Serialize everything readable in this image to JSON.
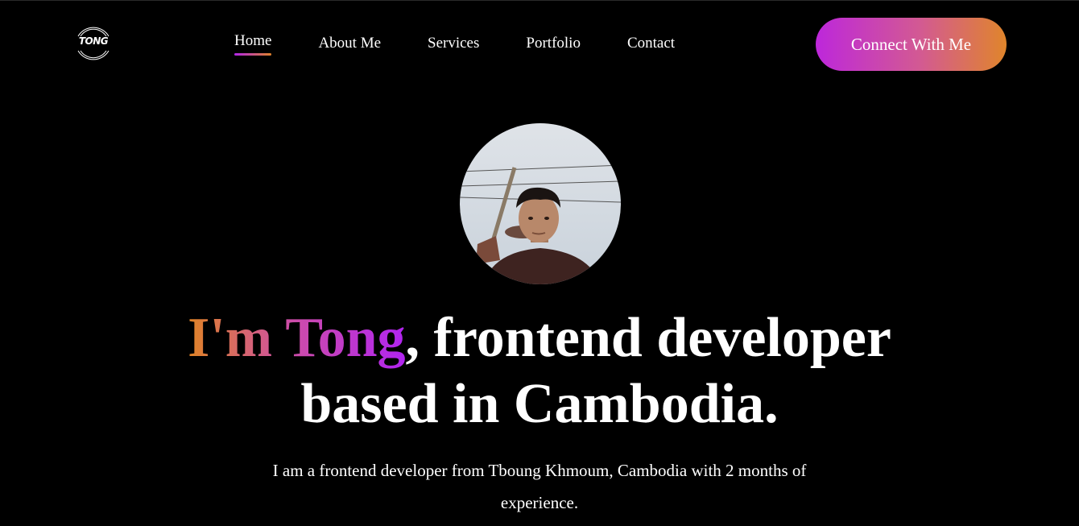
{
  "header": {
    "logo_text": "TONG",
    "nav": [
      {
        "label": "Home",
        "active": true
      },
      {
        "label": "About Me",
        "active": false
      },
      {
        "label": "Services",
        "active": false
      },
      {
        "label": "Portfolio",
        "active": false
      },
      {
        "label": "Contact",
        "active": false
      }
    ],
    "cta_label": "Connect With Me"
  },
  "hero": {
    "avatar_icon": "profile-photo",
    "headline_highlight": "I'm Tong",
    "headline_line1_rest": ", frontend developer",
    "headline_line2": "based in Cambodia.",
    "description": "I am a frontend developer from Tboung Khmoum, Cambodia with 2 months of experience."
  },
  "colors": {
    "background": "#000000",
    "gradient_start": "#b125e8",
    "gradient_end": "#e0822a",
    "text": "#ffffff"
  }
}
